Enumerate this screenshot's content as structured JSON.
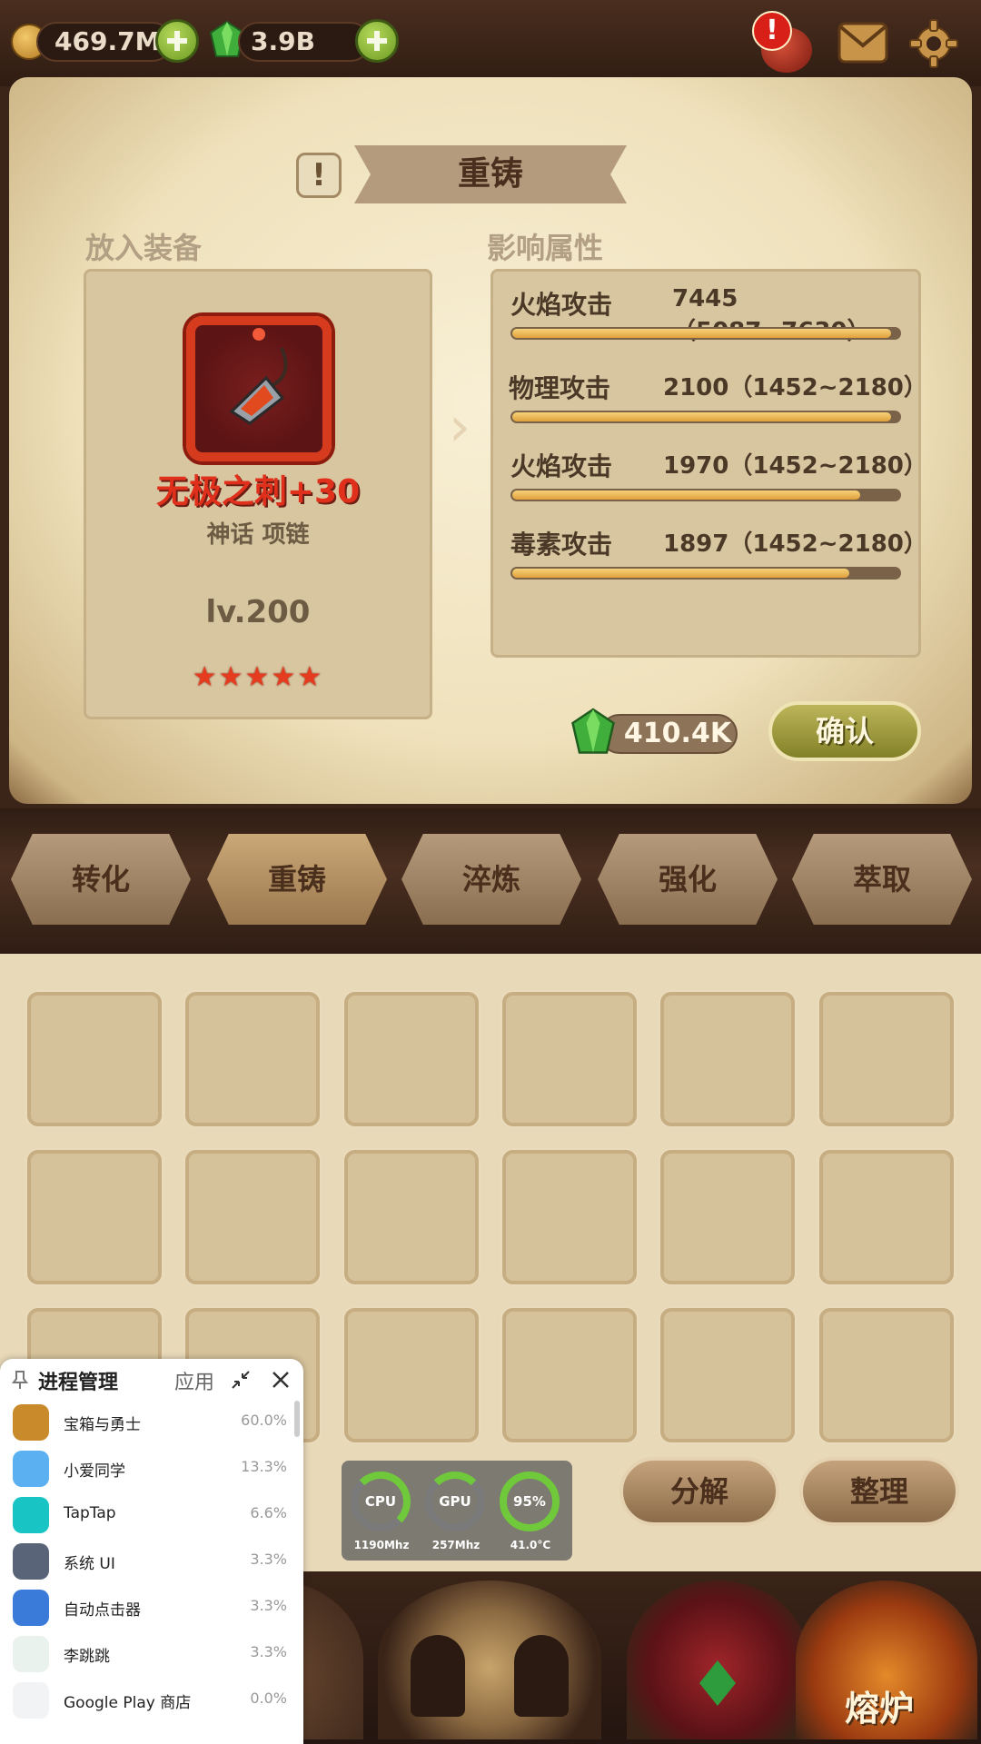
{
  "currency": {
    "gold": "469.7M",
    "gems": "3.9B"
  },
  "panel": {
    "title": "重铸",
    "put_equipment_label": "放入装备",
    "affected_attrs_label": "影响属性"
  },
  "item": {
    "name": "无极之刺+30",
    "type": "神话 项链",
    "level": "lv.200",
    "stars": "★★★★★",
    "star_count": 5
  },
  "attributes": [
    {
      "name": "火焰攻击",
      "value": "7445（5087~7630）",
      "fill": 0.98
    },
    {
      "name": "物理攻击",
      "value": "2100（1452~2180）",
      "fill": 0.98
    },
    {
      "name": "火焰攻击",
      "value": "1970（1452~2180）",
      "fill": 0.9
    },
    {
      "name": "毒素攻击",
      "value": "1897（1452~2180）",
      "fill": 0.87
    }
  ],
  "cost": "410.4K",
  "confirm_label": "确认",
  "tabs": [
    "转化",
    "重铸",
    "淬炼",
    "强化",
    "萃取"
  ],
  "active_tab": "重铸",
  "actions": {
    "decompose": "分解",
    "organize": "整理"
  },
  "bottom_nav": {
    "furnace": "熔炉"
  },
  "perf": {
    "cpu_label": "CPU",
    "cpu_freq": "1190Mhz",
    "gpu_label": "GPU",
    "gpu_freq": "257Mhz",
    "battery": "95%",
    "temp": "41.0°C"
  },
  "process_manager": {
    "title": "进程管理",
    "apps_label": "应用",
    "rows": [
      {
        "name": "宝箱与勇士",
        "pct": "60.0%",
        "color": "#c88a2a"
      },
      {
        "name": "小爱同学",
        "pct": "13.3%",
        "color": "#5ab0f0"
      },
      {
        "name": "TapTap",
        "pct": "6.6%",
        "color": "#19c4c4"
      },
      {
        "name": "系统 UI",
        "pct": "3.3%",
        "color": "#5a6478"
      },
      {
        "name": "自动点击器",
        "pct": "3.3%",
        "color": "#3a7ad8"
      },
      {
        "name": "李跳跳",
        "pct": "3.3%",
        "color": "#e9f2ec"
      },
      {
        "name": "Google Play 商店",
        "pct": "0.0%",
        "color": "#f1f3f4"
      }
    ]
  },
  "colors": {
    "accent_red": "#e0301c",
    "confirm_green": "#9a9a3a",
    "parchment": "#efe1bb"
  }
}
